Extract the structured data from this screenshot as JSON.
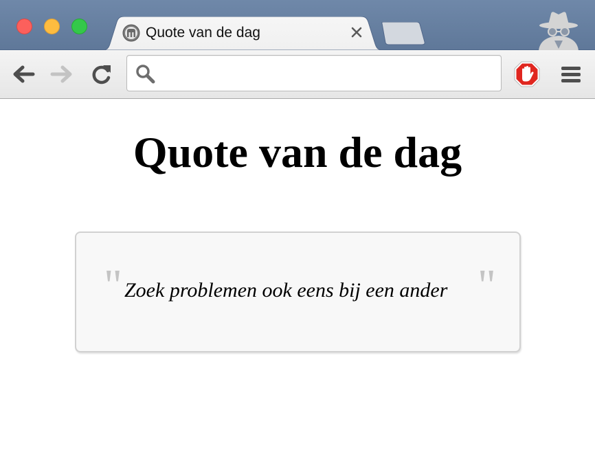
{
  "window": {
    "controls": {
      "close": "close-window",
      "minimize": "minimize-window",
      "zoom": "zoom-window"
    }
  },
  "tab": {
    "title": "Quote van de dag",
    "favicon_icon": "blog-favicon-icon",
    "close_symbol": "×"
  },
  "toolbar": {
    "address_value": "",
    "address_placeholder": "",
    "icons": [
      "back-arrow-icon",
      "forward-arrow-icon",
      "reload-icon",
      "search-icon",
      "adblock-stop-hand-icon",
      "hamburger-menu-icon",
      "incognito-icon"
    ]
  },
  "page": {
    "heading": "Quote van de dag",
    "quote": {
      "open_mark": "\"",
      "text": "Zoek problemen ook eens bij een ander",
      "close_mark": "\""
    }
  },
  "colors": {
    "titlebar": "#6a83a4",
    "toolbar": "#ececec",
    "quote_box_bg": "#f8f8f8",
    "quote_box_border": "#d1d1d1",
    "quote_mark": "#c4c4c4",
    "adblock_red": "#e0261f"
  }
}
